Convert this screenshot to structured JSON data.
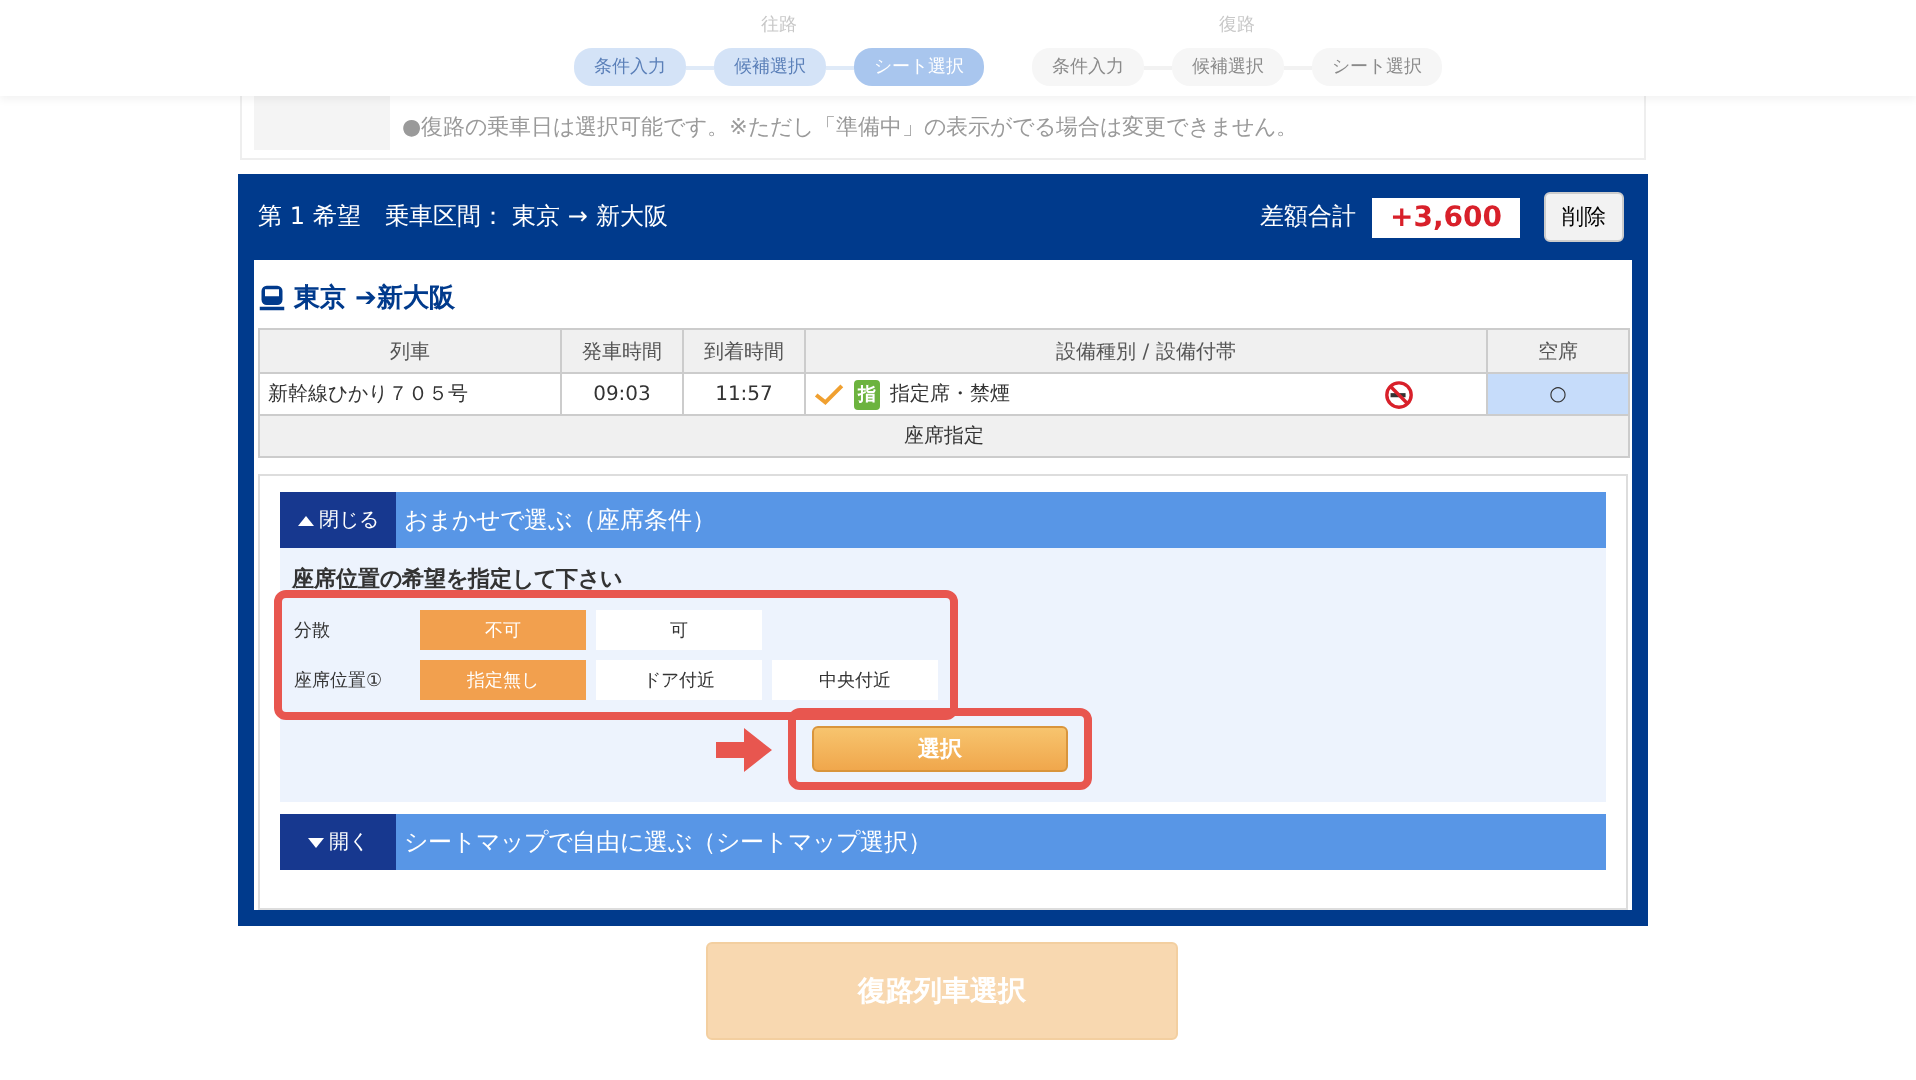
{
  "progress": {
    "groups": [
      {
        "label": "往路",
        "steps": [
          {
            "label": "条件入力",
            "completed": true,
            "selected": false
          },
          {
            "label": "候補選択",
            "completed": true,
            "selected": false
          },
          {
            "label": "シート選択",
            "completed": false,
            "selected": true
          }
        ]
      },
      {
        "label": "復路",
        "steps": [
          {
            "label": "条件入力",
            "completed": false,
            "selected": false
          },
          {
            "label": "候補選択",
            "completed": false,
            "selected": false
          },
          {
            "label": "シート選択",
            "completed": false,
            "selected": false
          }
        ]
      }
    ]
  },
  "notice": {
    "text": "●復路の乗車日は選択可能です。※ただし「準備中」の表示がでる場合は変更できません。"
  },
  "request": {
    "title": "第 1 希望",
    "route": "乗車区間： 東京 → 新大阪",
    "difference_label": "差額合計",
    "difference": "+3,600",
    "delete_button": "削除"
  },
  "train_heading": "東京 ➔新大阪",
  "table": {
    "columns": [
      "列車",
      "発車時間",
      "到着時間",
      "設備種別 / 設備付帯",
      "空席"
    ],
    "rows": [
      {
        "train": "新幹線ひかり７０５号",
        "departure": "09:03",
        "arrival": "11:57",
        "checked": true,
        "badge": "指",
        "facility": "指定席・禁煙",
        "non_smoking": true,
        "vacancy": "○",
        "selected": true
      }
    ],
    "footer": "座席指定"
  },
  "omakase": {
    "toggle": "閉じる",
    "expanded": true,
    "title": "おまかせで選ぶ（座席条件）",
    "instruction": "座席位置の希望を指定して下さい",
    "highlighted": true,
    "options": [
      {
        "label": "分散",
        "choices": [
          {
            "label": "不可",
            "selected": true
          },
          {
            "label": "可",
            "selected": false
          }
        ]
      },
      {
        "label": "座席位置①",
        "choices": [
          {
            "label": "指定無し",
            "selected": true
          },
          {
            "label": "ドア付近",
            "selected": false
          },
          {
            "label": "中央付近",
            "selected": false
          }
        ]
      }
    ],
    "select_button": {
      "label": "選択",
      "highlighted": true
    }
  },
  "seatmap": {
    "toggle": "開く",
    "expanded": false,
    "title": "シートマップで自由に選ぶ（シートマップ選択）"
  },
  "next_button": {
    "label": "復路列車選択",
    "disabled": true
  }
}
